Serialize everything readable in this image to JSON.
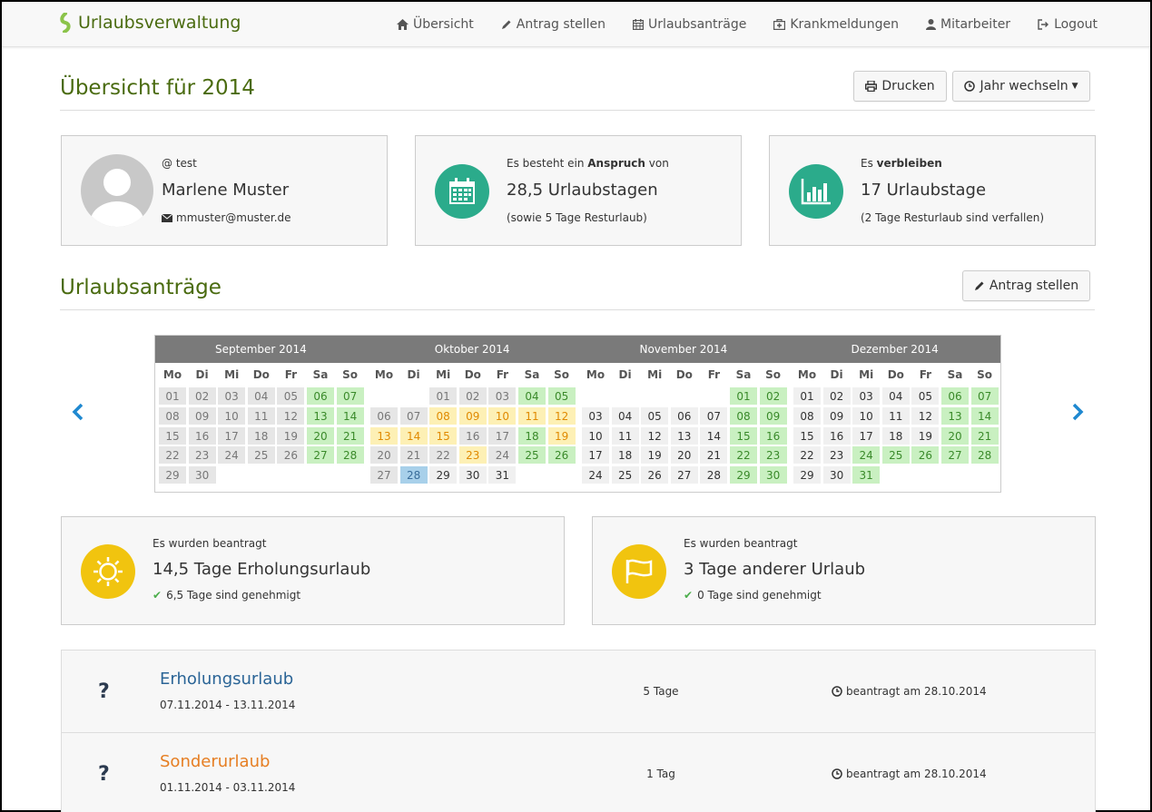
{
  "nav": {
    "brand": "Urlaubsverwaltung",
    "items": [
      {
        "label": "Übersicht",
        "icon": "home-icon"
      },
      {
        "label": "Antrag stellen",
        "icon": "pencil-icon"
      },
      {
        "label": "Urlaubsanträge",
        "icon": "calendar-icon"
      },
      {
        "label": "Krankmeldungen",
        "icon": "medkit-icon"
      },
      {
        "label": "Mitarbeiter",
        "icon": "user-icon"
      },
      {
        "label": "Logout",
        "icon": "logout-icon"
      }
    ]
  },
  "overview": {
    "title": "Übersicht für 2014",
    "print": "Drucken",
    "change_year": "Jahr wechseln"
  },
  "user": {
    "username": "@ test",
    "name": "Marlene Muster",
    "email": "mmuster@muster.de"
  },
  "entitlement": {
    "pre": "Es besteht ein",
    "bold": "Anspruch",
    "post": "von",
    "value": "28,5 Urlaubstagen",
    "note": "(sowie 5 Tage Resturlaub)"
  },
  "remaining": {
    "pre": "Es",
    "bold": "verbleiben",
    "value": "17 Urlaubstage",
    "note": "(2 Tage Resturlaub sind verfallen)"
  },
  "applications": {
    "title": "Urlaubsanträge",
    "new": "Antrag stellen"
  },
  "calendar": {
    "weekdays": [
      "Mo",
      "Di",
      "Mi",
      "Do",
      "Fr",
      "Sa",
      "So"
    ],
    "months": [
      {
        "name": "September 2014",
        "offset": 0,
        "days": 30,
        "status": {}
      },
      {
        "name": "Oktober 2014",
        "offset": 2,
        "days": 31,
        "status": {
          "8": "p",
          "9": "p",
          "10": "p",
          "11": "p",
          "12": "p",
          "13": "p",
          "14": "p",
          "15": "p",
          "19": "p",
          "23": "p",
          "28": "t"
        }
      },
      {
        "name": "November 2014",
        "offset": 5,
        "days": 30,
        "status": {}
      },
      {
        "name": "Dezember 2014",
        "offset": 0,
        "days": 31,
        "status": {
          "24": "h",
          "25": "h",
          "26": "h",
          "31": "h"
        }
      }
    ],
    "colors": {
      "weekend": "#c9f0c1",
      "past": "#e6e6e6",
      "pending": "#fdf0b5",
      "today": "#a8d0ea",
      "future": "#f0f0f0"
    }
  },
  "stat1": {
    "label": "Es wurden beantragt",
    "value": "14,5 Tage Erholungsurlaub",
    "approved": "6,5 Tage sind genehmigt"
  },
  "stat2": {
    "label": "Es wurden beantragt",
    "value": "3 Tage anderer Urlaub",
    "approved": "0 Tage sind genehmigt"
  },
  "requests": [
    {
      "status": "?",
      "type": "Erholungsurlaub",
      "dates": "07.11.2014 - 13.11.2014",
      "duration": "5 Tage",
      "applied": "beantragt am 28.10.2014",
      "color": "#2a6496"
    },
    {
      "status": "?",
      "type": "Sonderurlaub",
      "dates": "01.11.2014 - 03.11.2014",
      "duration": "1 Tag",
      "applied": "beantragt am 28.10.2014",
      "color": "#e67e22"
    }
  ]
}
